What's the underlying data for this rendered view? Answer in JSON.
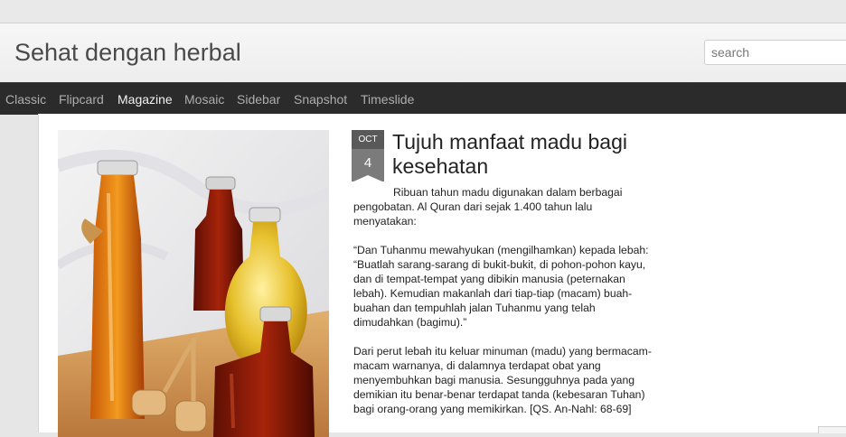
{
  "blog": {
    "title": "Sehat dengan herbal"
  },
  "search": {
    "placeholder": "search"
  },
  "nav": {
    "items": [
      {
        "label": "Classic"
      },
      {
        "label": "Flipcard"
      },
      {
        "label": "Magazine"
      },
      {
        "label": "Mosaic"
      },
      {
        "label": "Sidebar"
      },
      {
        "label": "Snapshot"
      },
      {
        "label": "Timeslide"
      }
    ],
    "active": "Magazine"
  },
  "post": {
    "date": {
      "month": "OCT",
      "day": "4"
    },
    "title": "Tujuh manfaat madu bagi kesehatan",
    "paragraphs": [
      "Ribuan tahun madu digunakan dalam berbagai pengobatan. Al Quran dari sejak 1.400 tahun lalu menyatakan:",
      "“Dan Tuhanmu mewahyukan (mengilhamkan) kepada lebah: “Buatlah sarang-sarang di bukit-bukit, di pohon-pohon kayu, dan di tempat-tempat yang dibikin manusia (peternakan lebah). Kemudian makanlah dari tiap-tiap (macam) buah-buahan dan tempuhlah jalan Tuhanmu yang telah dimudahkan (bagimu).”",
      "Dari perut lebah itu keluar minuman (madu) yang bermacam-macam warnanya, di dalamnya terdapat obat yang menyembuhkan bagi manusia. Sesungguhnya pada yang demikian itu benar-benar terdapat tanda (kebesaran Tuhan) bagi orang-orang yang memikirkan. [QS. An-Nahl: 68-69]"
    ]
  },
  "colors": {
    "navbar": "#2b2b2b",
    "nav_text": "#aeaeae",
    "nav_active": "#f2f2f2",
    "date_month_bg": "#595959",
    "date_day_bg": "#7b7b7b"
  }
}
